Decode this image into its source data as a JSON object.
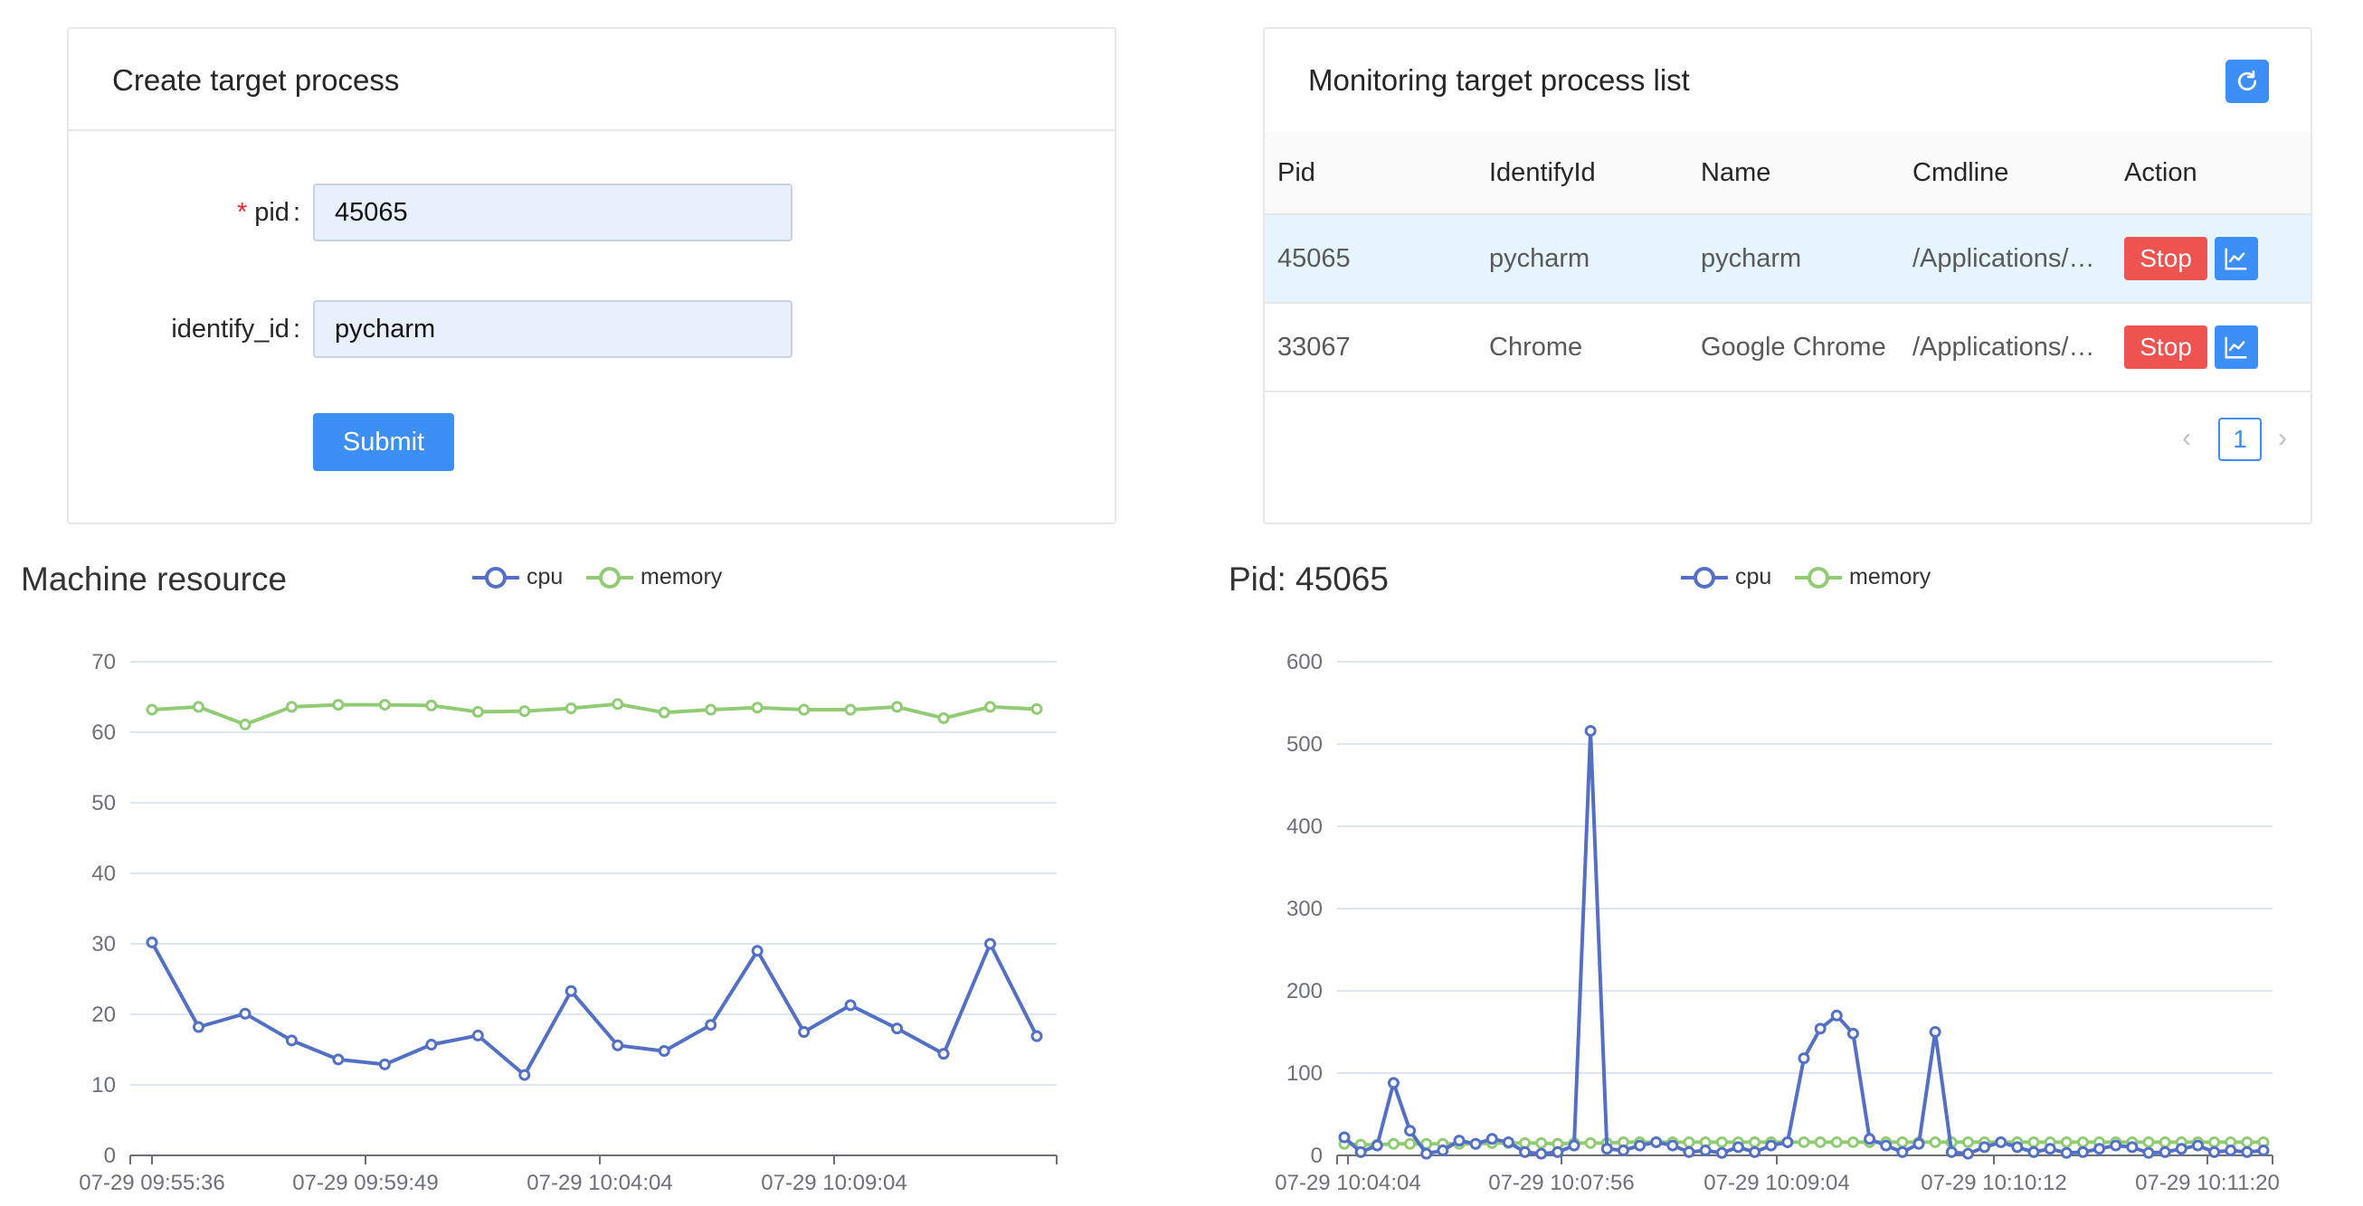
{
  "form_card": {
    "title": "Create target process",
    "pid_label": "pid",
    "pid_value": "45065",
    "identify_label": "identify_id",
    "identify_value": "pycharm",
    "submit_label": "Submit"
  },
  "list_card": {
    "title": "Monitoring target process list",
    "columns": [
      "Pid",
      "IdentifyId",
      "Name",
      "Cmdline",
      "Action"
    ],
    "rows": [
      {
        "pid": "45065",
        "identify_id": "pycharm",
        "name": "pycharm",
        "cmdline": "/Applications/PyCharm.app/Contents/MacOS/pycharm",
        "stop_label": "Stop"
      },
      {
        "pid": "33067",
        "identify_id": "Chrome",
        "name": "Google Chrome",
        "cmdline": "/Applications/Google Chrome.app/Contents/MacOS/Google Chrome",
        "stop_label": "Stop"
      }
    ],
    "pagination": {
      "current_page": "1"
    }
  },
  "colors": {
    "primary": "#3d8ff8",
    "danger": "#ef5350",
    "cpu_series": "#5470c6",
    "memory_series": "#91cc75"
  },
  "chart_data": [
    {
      "type": "line",
      "title": "Machine resource",
      "x_tick_labels": [
        "07-29 09:55:36",
        "07-29 09:59:49",
        "07-29 10:04:04",
        "07-29 10:09:04"
      ],
      "y_tick_labels": [
        "0",
        "10",
        "20",
        "30",
        "40",
        "50",
        "60",
        "70"
      ],
      "ylim": [
        0,
        70
      ],
      "legend": "top-center",
      "series": [
        {
          "name": "cpu",
          "values": [
            30.2,
            18.2,
            20.1,
            16.3,
            13.6,
            12.9,
            15.7,
            17.0,
            11.4,
            23.3,
            15.6,
            14.8,
            18.5,
            29.0,
            17.5,
            21.3,
            18.0,
            14.4,
            30.0,
            16.9
          ]
        },
        {
          "name": "memory",
          "values": [
            63.2,
            63.6,
            61.1,
            63.6,
            63.9,
            63.9,
            63.8,
            62.9,
            63.0,
            63.4,
            64.0,
            62.8,
            63.2,
            63.5,
            63.2,
            63.2,
            63.6,
            62.0,
            63.6,
            63.3
          ]
        }
      ]
    },
    {
      "type": "line",
      "title": "Pid: 45065",
      "x_tick_labels": [
        "07-29 10:04:04",
        "07-29 10:07:56",
        "07-29 10:09:04",
        "07-29 10:10:12",
        "07-29 10:11:20"
      ],
      "y_tick_labels": [
        "0",
        "100",
        "200",
        "300",
        "400",
        "500",
        "600"
      ],
      "ylim": [
        0,
        600
      ],
      "legend": "top-center",
      "series": [
        {
          "name": "cpu",
          "values": [
            22,
            4,
            12,
            88,
            30,
            2,
            6,
            18,
            14,
            20,
            16,
            4,
            2,
            4,
            12,
            516,
            8,
            6,
            12,
            16,
            12,
            4,
            6,
            3,
            10,
            4,
            12,
            16,
            118,
            154,
            170,
            148,
            20,
            12,
            4,
            14,
            150,
            4,
            2,
            10,
            16,
            10,
            4,
            8,
            3,
            4,
            8,
            12,
            10,
            3,
            4,
            8,
            12,
            4,
            6,
            4,
            6
          ]
        },
        {
          "name": "memory",
          "values": [
            14,
            13,
            13,
            14,
            14,
            14,
            14,
            14,
            14,
            15,
            15,
            15,
            15,
            14,
            15,
            15,
            15,
            16,
            16,
            16,
            16,
            16,
            16,
            16,
            16,
            16,
            16,
            16,
            16,
            16,
            16,
            16,
            16,
            16,
            16,
            16,
            16,
            16,
            16,
            16,
            16,
            16,
            16,
            16,
            16,
            16,
            16,
            16,
            16,
            16,
            16,
            16,
            16,
            16,
            16,
            16,
            16
          ]
        }
      ]
    }
  ]
}
